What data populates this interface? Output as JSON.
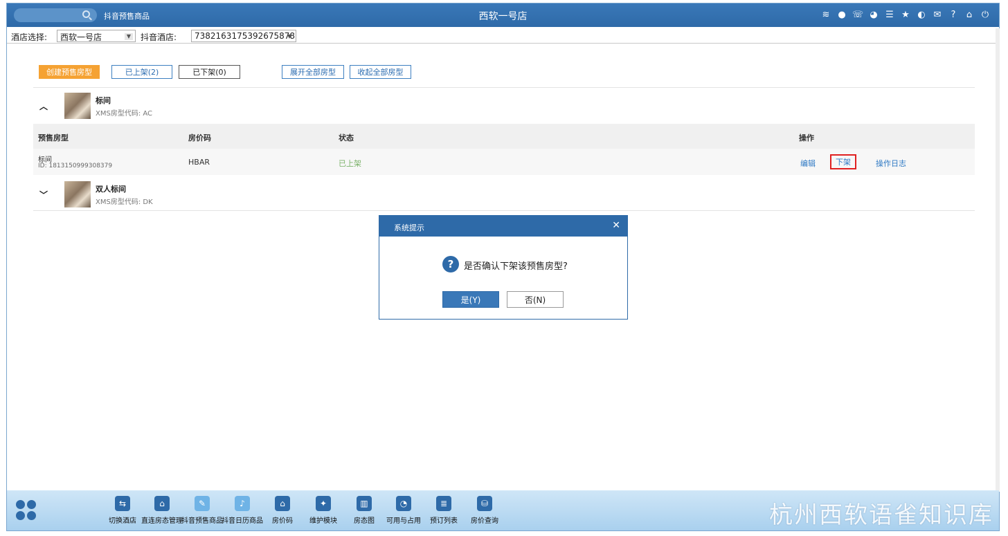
{
  "topbar": {
    "breadcrumb": "抖音预售商品",
    "title": "西软一号店",
    "icons": [
      "wifi-icon",
      "chat-icon",
      "phone-icon",
      "palette-icon",
      "menu-icon",
      "star-icon",
      "contrast-icon",
      "mail-icon",
      "help-icon",
      "home-icon",
      "power-icon"
    ]
  },
  "selectors": {
    "hotel_label": "酒店选择:",
    "hotel_value": "西软一号店",
    "douyin_label": "抖音酒店:",
    "douyin_value": "7382163175392675878"
  },
  "toolbar": {
    "create": "创建预售房型",
    "listed": "已上架(2)",
    "delisted": "已下架(0)",
    "expand_all": "展开全部房型",
    "collapse_all": "收起全部房型"
  },
  "rooms": [
    {
      "name": "标间",
      "code": "XMS房型代码: AC",
      "expanded": true
    },
    {
      "name": "双人标间",
      "code": "XMS房型代码: DK",
      "expanded": false
    }
  ],
  "table": {
    "headers": [
      "预售房型",
      "房价码",
      "状态",
      "操作"
    ],
    "row": {
      "name": "标间",
      "id": "ID: 1813150999308379",
      "rate_code": "HBAR",
      "status": "已上架",
      "actions": [
        "编辑",
        "下架",
        "操作日志"
      ]
    }
  },
  "dialog": {
    "title": "系统提示",
    "message": "是否确认下架该预售房型?",
    "yes": "是(Y)",
    "no": "否(N)"
  },
  "dock": [
    {
      "label": "切换酒店",
      "icon": "switch-icon"
    },
    {
      "label": "直连房态管理",
      "icon": "house-gear-icon"
    },
    {
      "label": "抖音预售商品",
      "icon": "edit-doc-icon"
    },
    {
      "label": "抖音日历商品",
      "icon": "tiktok-icon"
    },
    {
      "label": "房价码",
      "icon": "home-icon"
    },
    {
      "label": "维护模块",
      "icon": "wrench-icon"
    },
    {
      "label": "房态图",
      "icon": "bank-icon"
    },
    {
      "label": "可用与占用",
      "icon": "pie-icon"
    },
    {
      "label": "预订列表",
      "icon": "list-doc-icon"
    },
    {
      "label": "房价查询",
      "icon": "price-query-icon"
    }
  ],
  "watermark": "杭州西软语雀知识库"
}
